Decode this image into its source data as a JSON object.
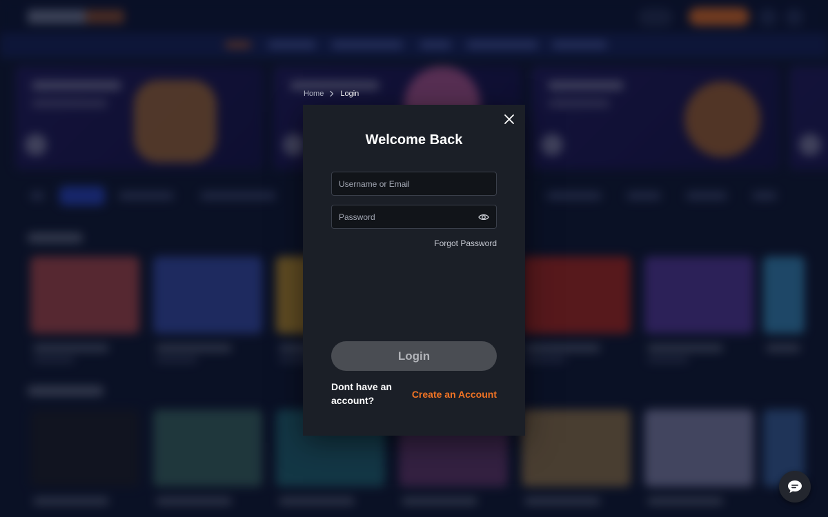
{
  "breadcrumb": {
    "home": "Home",
    "current": "Login"
  },
  "login_modal": {
    "title": "Welcome Back",
    "username_placeholder": "Username or Email",
    "password_placeholder": "Password",
    "forgot_password": "Forgot Password",
    "login_button": "Login",
    "no_account_text": "Dont have an account?",
    "create_account_link": "Create an Account"
  },
  "icons": {
    "close": "close-icon",
    "password_toggle": "eye-icon",
    "breadcrumb_separator": "chevron-right-icon",
    "chat": "chat-icon"
  },
  "colors": {
    "accent": "#f07324",
    "modal_background": "#1b1f27",
    "page_background": "#0f1730",
    "button_disabled": "#4a4d53"
  }
}
